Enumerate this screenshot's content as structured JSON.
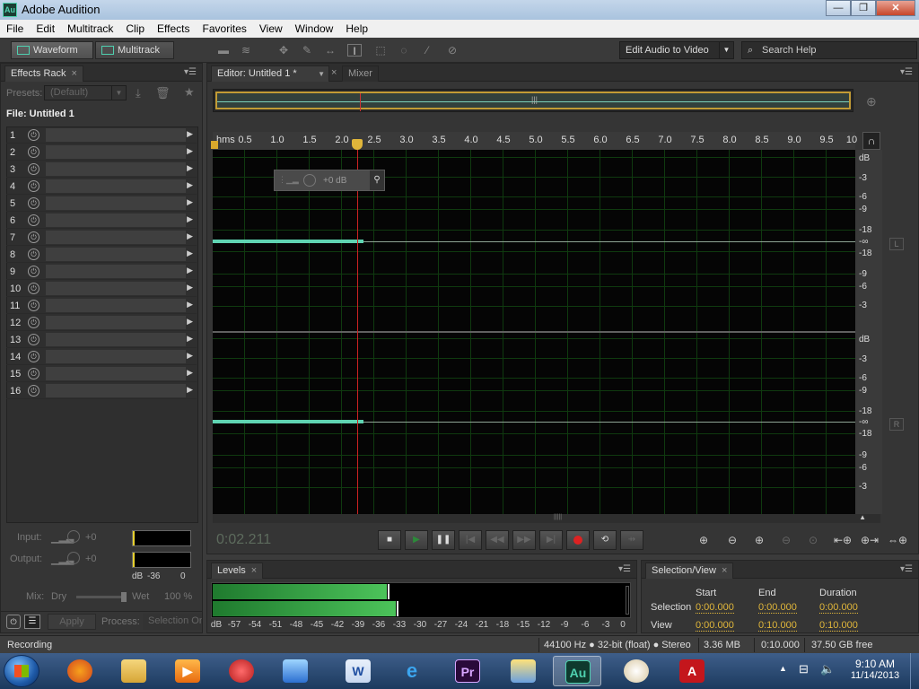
{
  "window": {
    "title": "Adobe Audition",
    "app_icon": "Au",
    "minimize": "—",
    "maximize": "❐",
    "close": "✕"
  },
  "menu": [
    "File",
    "Edit",
    "Multitrack",
    "Clip",
    "Effects",
    "Favorites",
    "View",
    "Window",
    "Help"
  ],
  "toolbar": {
    "waveform": "Waveform",
    "multitrack": "Multitrack",
    "workspace": "Edit Audio to Video",
    "search_placeholder": "Search Help"
  },
  "effects_rack": {
    "tab": "Effects Rack",
    "presets_label": "Presets:",
    "presets_value": "(Default)",
    "file": "File: Untitled 1",
    "rows": [
      "1",
      "2",
      "3",
      "4",
      "5",
      "6",
      "7",
      "8",
      "9",
      "10",
      "11",
      "12",
      "13",
      "14",
      "15",
      "16"
    ],
    "input_label": "Input:",
    "input_value": "+0",
    "output_label": "Output:",
    "output_value": "+0",
    "meter_db": "dB",
    "meter_m36": "-36",
    "meter_zero": "0",
    "mix_label": "Mix:",
    "dry": "Dry",
    "wet": "Wet",
    "wet_value": "100 %",
    "apply": "Apply",
    "process_label": "Process:",
    "process_value": "Selection On"
  },
  "editor": {
    "tab": "Editor: Untitled 1 *",
    "mixer_tab": "Mixer",
    "ruler_unit": "hms",
    "ruler_ticks": [
      "0.5",
      "1.0",
      "1.5",
      "2.0",
      "2.5",
      "3.0",
      "3.5",
      "4.0",
      "4.5",
      "5.0",
      "5.5",
      "6.0",
      "6.5",
      "7.0",
      "7.5",
      "8.0",
      "8.5",
      "9.0",
      "9.5",
      "10"
    ],
    "hud_gain": "+0 dB",
    "db_labels_top": [
      "dB",
      "-3",
      "-6",
      "-9",
      "-18",
      "-∞",
      "-18",
      "-9",
      "-6",
      "-3"
    ],
    "db_labels_bottom": [
      "dB",
      "-3",
      "-6",
      "-9",
      "-18",
      "-∞",
      "-18",
      "-9",
      "-6",
      "-3"
    ],
    "channel_left": "L",
    "channel_right": "R",
    "current_time": "0:02.211"
  },
  "levels": {
    "tab": "Levels",
    "scale": [
      "dB",
      "-57",
      "-54",
      "-51",
      "-48",
      "-45",
      "-42",
      "-39",
      "-36",
      "-33",
      "-30",
      "-27",
      "-24",
      "-21",
      "-18",
      "-15",
      "-12",
      "-9",
      "-6",
      "-3",
      "0"
    ]
  },
  "selection_view": {
    "tab": "Selection/View",
    "col_start": "Start",
    "col_end": "End",
    "col_duration": "Duration",
    "selection_label": "Selection",
    "view_label": "View",
    "sel_start": "0:00.000",
    "sel_end": "0:00.000",
    "sel_duration": "0:00.000",
    "view_start": "0:00.000",
    "view_end": "0:10.000",
    "view_duration": "0:10.000"
  },
  "status": {
    "state": "Recording",
    "format": "44100 Hz ● 32-bit (float) ● Stereo",
    "size": "3.36 MB",
    "duration": "0:10.000",
    "free": "37.50 GB free"
  },
  "taskbar": {
    "time": "9:10 AM",
    "date": "11/14/2013",
    "premiere": "Pr",
    "audition": "Au"
  }
}
